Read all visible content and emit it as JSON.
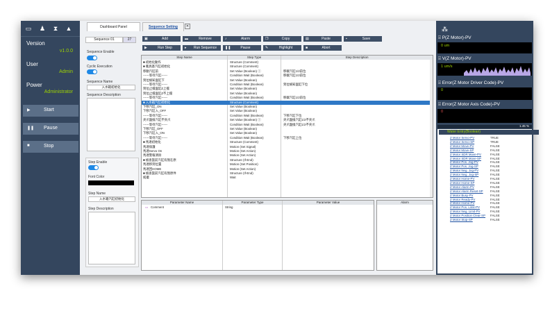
{
  "left": {
    "version_label": "Version",
    "version_value": "v1.0.0",
    "user_label": "User",
    "user_value": "Admin",
    "power_label": "Power",
    "power_value": "Administrator",
    "start": "Start",
    "pause": "Pause",
    "stop": "Stop"
  },
  "tabs": {
    "dashboard": "Dashboard Panel",
    "sequence": "Sequence Setting",
    "close": "✕"
  },
  "seq": {
    "name_value": "Sequence 01",
    "count": "27",
    "enable_label": "Sequence Enable",
    "cyclic_label": "Cyclic Execution",
    "name_label": "Sequence Name",
    "name_input": "入水箱初始化",
    "desc_label": "Sequence Description",
    "step_enable_label": "Step Enable",
    "font_color_label": "Font Color",
    "step_name_label": "Step Name",
    "step_name_input": "入水箱汽缸初始化",
    "step_desc_label": "Step Description"
  },
  "toolbar": {
    "add": "Add",
    "remove": "Remove",
    "alarm": "Alarm",
    "copy": "Copy",
    "paste": "Paste",
    "save": "Save",
    "run_step": "Run Step",
    "run_sequence": "Run Sequence",
    "pause": "Pause",
    "highlight": "Highlight",
    "abort": "Abort"
  },
  "steps": {
    "headers": [
      "Step Name",
      "Step Type",
      "Step Description"
    ],
    "rows": [
      {
        "name": "■  初始化動作",
        "type": "Structure (Comment)",
        "desc": ""
      },
      {
        "name": "    ■  載具基汽缸初始化",
        "type": "Structure (Comment)",
        "desc": ""
      },
      {
        "name": "           移動汽缸前",
        "type": "Set Value (Boolean) ⓘ",
        "desc": "移載汽缸1/2前位"
      },
      {
        "name": "           ------等待汽缸------",
        "type": "Condition Wait (Boolean)",
        "desc": "移載汽缸1/2前位"
      },
      {
        "name": "        到位檢知面缸下",
        "type": "Set Value (Boolean)",
        "desc": ""
      },
      {
        "name": "           ------等待汽缸------",
        "type": "Condition Wait (Boolean)",
        "desc": "到位檢知面缸下位"
      },
      {
        "name": "        到位止擋面缸Z上擋",
        "type": "Set Value (Boolean)",
        "desc": ""
      },
      {
        "name": "        到位止擋面缸Z不上擋",
        "type": "Set Value (Boolean)",
        "desc": ""
      },
      {
        "name": "           ------等待汽缸------",
        "type": "Condition Wait (Boolean)",
        "desc": "移載汽缸1/2前位"
      },
      {
        "name": "    ■  入水箱汽缸初始化",
        "type": "Structure (Comment)",
        "desc": ""
      },
      {
        "name": "           下移汽缸_ON",
        "type": "Set Value (Boolean)",
        "desc": ""
      },
      {
        "name": "           下移汽缸入_OFF",
        "type": "Set Value (Boolean)",
        "desc": ""
      },
      {
        "name": "           ------等待汽缸------",
        "type": "Condition Wait (Boolean)",
        "desc": "下移汽缸下位"
      },
      {
        "name": "        夾爪盤換汽缸不夾爪",
        "type": "Set Value (Boolean) ⓘ",
        "desc": "夾爪盤換汽缸1/2不夾爪"
      },
      {
        "name": "           ------等待汽缸------",
        "type": "Condition Wait (Boolean)",
        "desc": "夾爪盤換汽缸1/2不夾爪"
      },
      {
        "name": "           下移汽缸_OFF",
        "type": "Set Value (Boolean)",
        "desc": ""
      },
      {
        "name": "           下移汽缸入_ON",
        "type": "Set Value (Boolean)",
        "desc": ""
      },
      {
        "name": "           ------等待汽缸------",
        "type": "Condition Wait (Boolean)",
        "desc": "下移汽缸上位"
      },
      {
        "name": "    ■  馬達初始化",
        "type": "Structure (Comment)",
        "desc": ""
      },
      {
        "name": "           馬達保護",
        "type": "Motion (Set Signal)",
        "desc": ""
      },
      {
        "name": "           馬達Servo On",
        "type": "Motion (Set Action)",
        "desc": ""
      },
      {
        "name": "           馬達警報清除",
        "type": "Motion (Set Action)",
        "desc": ""
      },
      {
        "name": "        ■  檢查當前汽缸有無在原",
        "type": "Structure (If-End)",
        "desc": ""
      },
      {
        "name": "              馬達移到位置",
        "type": "Motion (Set Position)",
        "desc": ""
      },
      {
        "name": "              馬達回HOME",
        "type": "Motion (Set Action)",
        "desc": ""
      },
      {
        "name": "        ■  檢查當前汽缸有無原件",
        "type": "Structure (If-End)",
        "desc": ""
      },
      {
        "name": "              搖擺",
        "type": "Wait",
        "desc": ""
      }
    ]
  },
  "params": {
    "headers": [
      "Parameter Name",
      "Parameter Type",
      "Parameter Value"
    ],
    "row_name": "Comment",
    "row_type": "String",
    "alarm_header": "Alarm"
  },
  "right": {
    "plot1_title": "P(Z Motor)-PV",
    "plot1_val": "0 um",
    "plot2_title": "V(Z Motor)-PV",
    "plot2_val": "1 um/s",
    "plot3_title": "Error(Z Motor Driver Code)-PV",
    "plot3_val": "0",
    "plot4_title": "Error(Z Motor Axis Code)-PV",
    "plot4_val": "0",
    "progress": "1.45 %",
    "water_entry": "Water Entry(Boolean)",
    "signals": [
      {
        "n": "Z Motor Servo-PV",
        "v": "TRUE"
      },
      {
        "n": "Z Motor Servo-SP",
        "v": "TRUE"
      },
      {
        "n": "Z Motor Move-PV",
        "v": "FALSE"
      },
      {
        "n": "Z Motor Move-SP",
        "v": "FALSE"
      },
      {
        "n": "Z Motor SDR Move-PV",
        "v": "FALSE"
      },
      {
        "n": "Z Motor SDR Move-SP",
        "v": "FALSE"
      },
      {
        "n": "Z Motor Pos. Jog-PV",
        "v": "FALSE"
      },
      {
        "n": "Z Motor Pos. Jog-SP",
        "v": "FALSE"
      },
      {
        "n": "Z Motor Neg. Jog-PV",
        "v": "FALSE"
      },
      {
        "n": "Z Motor Neg. Jog-SP",
        "v": "FALSE"
      },
      {
        "n": "Z Motor Home-PV",
        "v": "FALSE"
      },
      {
        "n": "Z Motor Home-SP",
        "v": "FALSE"
      },
      {
        "n": "Z Motor Alarm-PV",
        "v": "FALSE"
      },
      {
        "n": "Z Motor Alarm Reset-SP",
        "v": "FALSE"
      },
      {
        "n": "Z Motor Busy-PV",
        "v": "FALSE"
      },
      {
        "n": "Z Motor Ready-PV",
        "v": "FALSE"
      },
      {
        "n": "Z Motor Home-PV",
        "v": "FALSE"
      },
      {
        "n": "Z Motor Pos. Limit-PV",
        "v": "FALSE"
      },
      {
        "n": "Z Motor Neg. Limit-PV",
        "v": "FALSE"
      },
      {
        "n": "Z Motor Position Clear-SP",
        "v": "FALSE"
      },
      {
        "n": "Z Motor Stop-SP",
        "v": "FALSE"
      }
    ]
  }
}
